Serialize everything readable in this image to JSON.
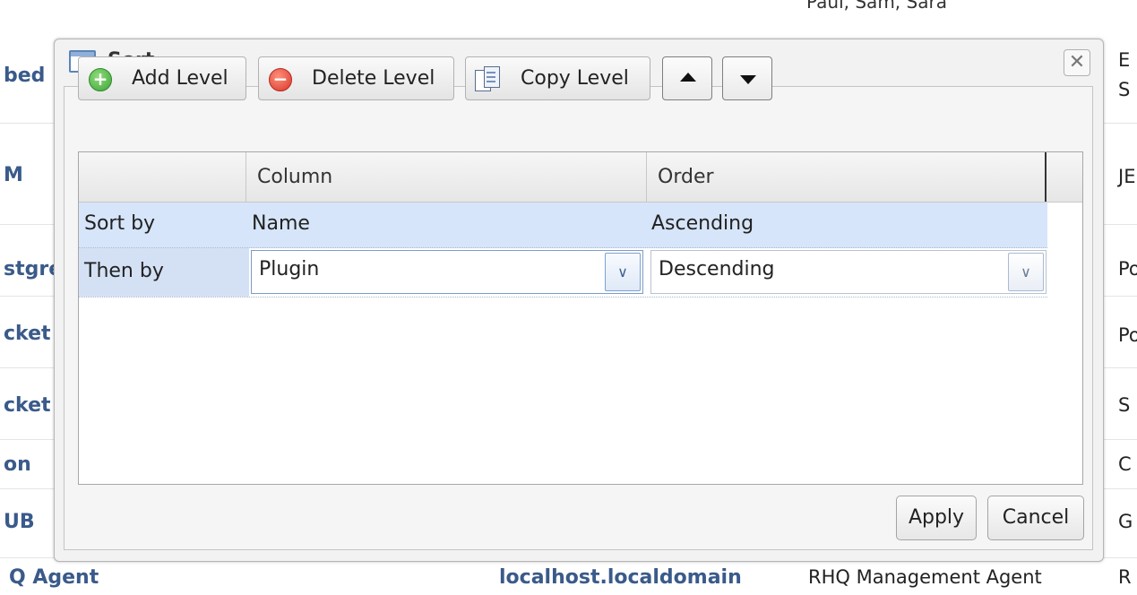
{
  "background": {
    "top_partial_text": "Paul, Sam, Sara",
    "left_column": [
      "bed",
      "M",
      "stgre",
      "cket",
      "cket",
      "on",
      "UB"
    ],
    "right_column": [
      "E",
      "S",
      "JE",
      "Po",
      "Po",
      "S",
      "C",
      "G"
    ],
    "bottom_row": {
      "name": "Q Agent",
      "host": "localhost.localdomain",
      "description": "RHQ Management Agent",
      "extra": "R"
    }
  },
  "dialog": {
    "title": "Sort",
    "close_glyph": "✕",
    "toolbar": {
      "add_level": "Add Level",
      "delete_level": "Delete Level",
      "copy_level": "Copy Level"
    },
    "grid": {
      "headers": {
        "row_label": "",
        "column": "Column",
        "order": "Order"
      },
      "rows": [
        {
          "label": "Sort by",
          "column": "Name",
          "order": "Ascending"
        },
        {
          "label": "Then by",
          "column": "Plugin",
          "order": "Descending"
        }
      ]
    },
    "footer": {
      "apply": "Apply",
      "cancel": "Cancel"
    }
  },
  "colors": {
    "selected_row": "#d6e5f9",
    "link_blue": "#3a5a8a",
    "accent_border": "#5b84b8"
  }
}
